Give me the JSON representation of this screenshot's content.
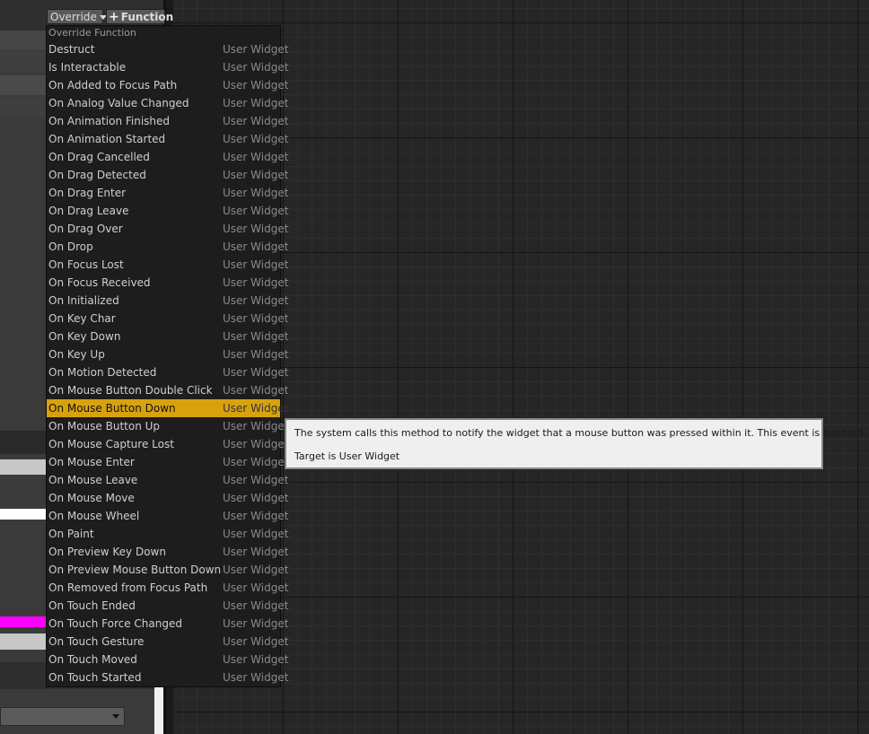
{
  "toolbar": {
    "override_label": "Override",
    "add_function_label": "Function"
  },
  "override_menu": {
    "header": "Override Function",
    "items": [
      {
        "name": "Destruct",
        "category": "User Widget"
      },
      {
        "name": "Is Interactable",
        "category": "User Widget"
      },
      {
        "name": "On Added to Focus Path",
        "category": "User Widget"
      },
      {
        "name": "On Analog Value Changed",
        "category": "User Widget"
      },
      {
        "name": "On Animation Finished",
        "category": "User Widget"
      },
      {
        "name": "On Animation Started",
        "category": "User Widget"
      },
      {
        "name": "On Drag Cancelled",
        "category": "User Widget"
      },
      {
        "name": "On Drag Detected",
        "category": "User Widget"
      },
      {
        "name": "On Drag Enter",
        "category": "User Widget"
      },
      {
        "name": "On Drag Leave",
        "category": "User Widget"
      },
      {
        "name": "On Drag Over",
        "category": "User Widget"
      },
      {
        "name": "On Drop",
        "category": "User Widget"
      },
      {
        "name": "On Focus Lost",
        "category": "User Widget"
      },
      {
        "name": "On Focus Received",
        "category": "User Widget"
      },
      {
        "name": "On Initialized",
        "category": "User Widget"
      },
      {
        "name": "On Key Char",
        "category": "User Widget"
      },
      {
        "name": "On Key Down",
        "category": "User Widget"
      },
      {
        "name": "On Key Up",
        "category": "User Widget"
      },
      {
        "name": "On Motion Detected",
        "category": "User Widget"
      },
      {
        "name": "On Mouse Button Double Click",
        "category": "User Widget"
      },
      {
        "name": "On Mouse Button Down",
        "category": "User Widget",
        "selected": true
      },
      {
        "name": "On Mouse Button Up",
        "category": "User Widget"
      },
      {
        "name": "On Mouse Capture Lost",
        "category": "User Widget"
      },
      {
        "name": "On Mouse Enter",
        "category": "User Widget"
      },
      {
        "name": "On Mouse Leave",
        "category": "User Widget"
      },
      {
        "name": "On Mouse Move",
        "category": "User Widget"
      },
      {
        "name": "On Mouse Wheel",
        "category": "User Widget"
      },
      {
        "name": "On Paint",
        "category": "User Widget"
      },
      {
        "name": "On Preview Key Down",
        "category": "User Widget"
      },
      {
        "name": "On Preview Mouse Button Down",
        "category": "User Widget"
      },
      {
        "name": "On Removed from Focus Path",
        "category": "User Widget"
      },
      {
        "name": "On Touch Ended",
        "category": "User Widget"
      },
      {
        "name": "On Touch Force Changed",
        "category": "User Widget"
      },
      {
        "name": "On Touch Gesture",
        "category": "User Widget"
      },
      {
        "name": "On Touch Moved",
        "category": "User Widget"
      },
      {
        "name": "On Touch Started",
        "category": "User Widget"
      }
    ]
  },
  "tooltip": {
    "description": "The system calls this method to notify the widget that a mouse button was pressed within it. This event is bubbled.",
    "target": "Target is User Widget"
  },
  "colors": {
    "selection_highlight": "#d8a20f",
    "magenta_swatch": "#ff00ff"
  },
  "icons": {
    "override_dropdown": "chevron-down-icon",
    "add_function": "plus-icon",
    "bottom_dropdown": "chevron-down-icon"
  }
}
